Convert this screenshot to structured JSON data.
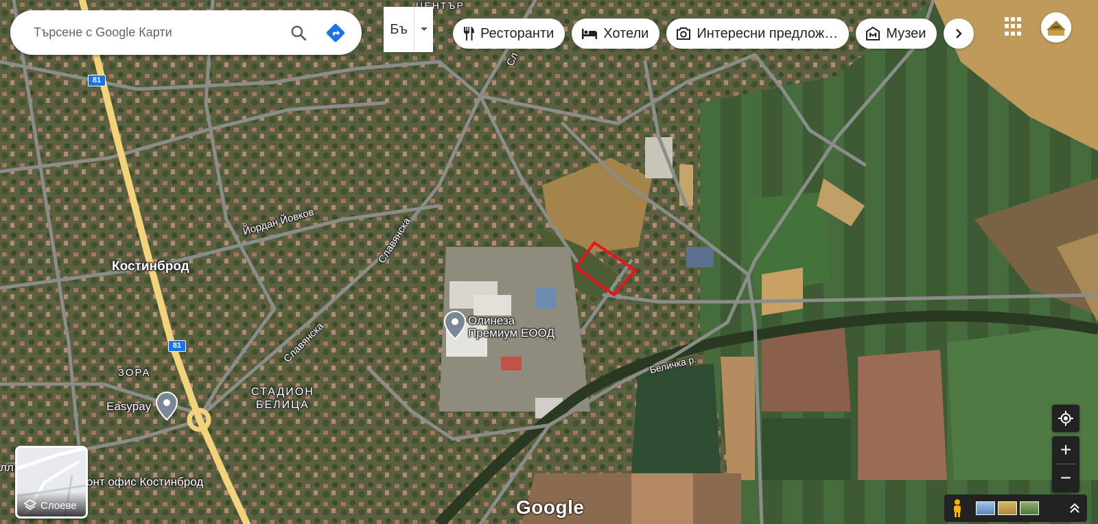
{
  "search": {
    "placeholder": "Търсене с Google Карти"
  },
  "lang": {
    "label": "Бъ"
  },
  "chips": [
    {
      "label": "Ресторанти",
      "icon": "fork-knife-icon"
    },
    {
      "label": "Хотели",
      "icon": "bed-icon"
    },
    {
      "label": "Интересни предлож…",
      "icon": "camera-icon"
    },
    {
      "label": "Музеи",
      "icon": "museum-icon"
    }
  ],
  "map": {
    "labels": {
      "town": "Костинброд",
      "street_yordan": "Йордан Йовков",
      "street_slav1": "Славянска",
      "street_slav2": "Славянска",
      "street_top": "Сл",
      "district_zora": "ЗОРА",
      "stadium_1": "СТАДИОН",
      "stadium_2": "БЕЛИЦА",
      "center": "ЦЕНТЪР",
      "river": "Беличка р.",
      "poi_olineza_1": "Олинеза",
      "poi_olineza_2": "Премиум ЕООД",
      "poi_easypay": "Easypay",
      "poi_office": "онт офис Костинброд",
      "edge_left": "лл",
      "road_81_a": "81",
      "road_81_b": "81"
    },
    "highlight_color": "#e8141e",
    "road_color": "#f2d27a"
  },
  "layers": {
    "label": "Слоеве"
  },
  "attribution": "Google"
}
